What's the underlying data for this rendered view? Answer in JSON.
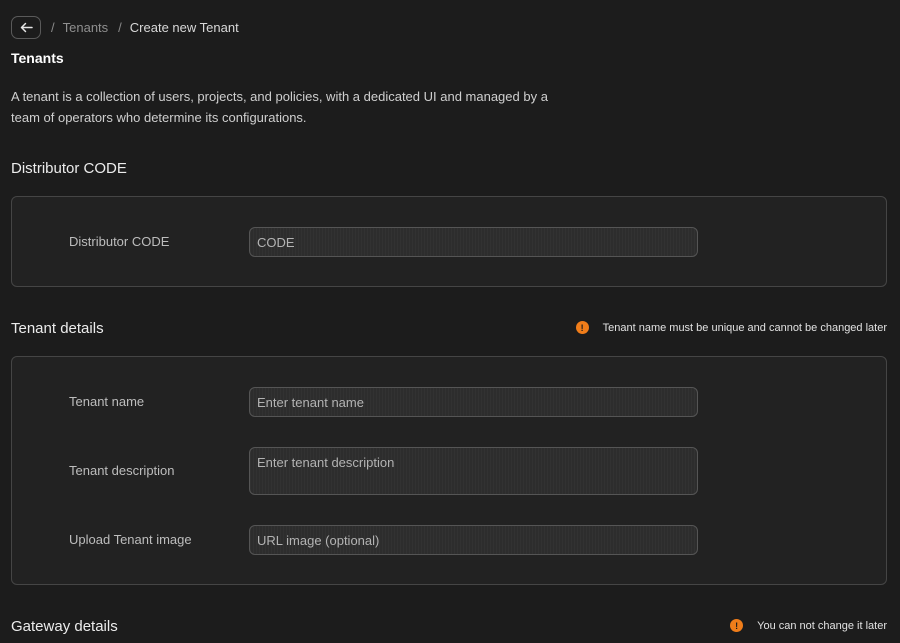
{
  "breadcrumb": {
    "items": [
      "Tenants",
      "Create new Tenant"
    ]
  },
  "page": {
    "title": "Tenants",
    "description": "A tenant is a collection of users, projects, and policies, with a dedicated UI and managed by a team of operators who determine its configurations."
  },
  "distributor": {
    "section_title": "Distributor CODE",
    "field_label": "Distributor CODE",
    "field_placeholder": "CODE"
  },
  "tenant_details": {
    "section_title": "Tenant details",
    "warning": "Tenant name must be unique and cannot be changed later",
    "name_label": "Tenant name",
    "name_placeholder": "Enter tenant name",
    "description_label": "Tenant description",
    "description_placeholder": "Enter tenant description",
    "image_label": "Upload Tenant image",
    "image_placeholder": "URL image (optional)"
  },
  "gateway_details": {
    "section_title": "Gateway details",
    "warning": "You can not change it later"
  },
  "colors": {
    "background": "#1c1c1c",
    "card": "#222222",
    "warning": "#f07d1a"
  },
  "icons": [
    "back-arrow-icon",
    "warning-icon"
  ]
}
